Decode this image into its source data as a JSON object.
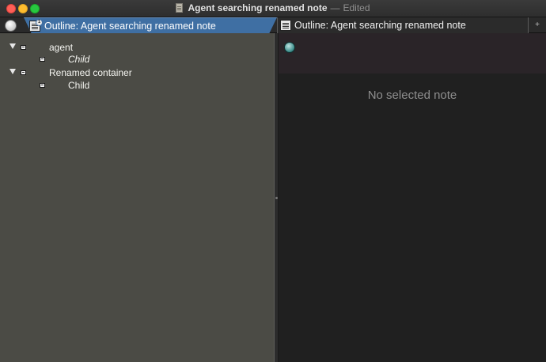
{
  "window": {
    "title": "Agent searching renamed note",
    "separator": "—",
    "status": "Edited"
  },
  "tabs": [
    {
      "label": "Outline: Agent searching renamed note",
      "icon": "outline-icon",
      "badge": "1",
      "active": true
    },
    {
      "label": "Outline: Agent searching renamed note",
      "icon": "outline-icon",
      "active": false
    }
  ],
  "tabbar": {
    "add_label": "+"
  },
  "outline": {
    "items": [
      {
        "label": "agent",
        "expanded": true,
        "level": 0,
        "italic": false
      },
      {
        "label": "Child",
        "level": 1,
        "italic": true
      },
      {
        "label": "Renamed container",
        "expanded": true,
        "level": 0,
        "italic": false
      },
      {
        "label": "Child",
        "level": 1,
        "italic": false
      }
    ]
  },
  "detail": {
    "empty_message": "No selected note"
  },
  "colors": {
    "active_tab": "#3f6fa3",
    "outline_background": "#4b4b45",
    "detail_background": "#202020",
    "close": "#fe5f57",
    "minimize": "#febc2e",
    "maximize": "#28c840"
  }
}
